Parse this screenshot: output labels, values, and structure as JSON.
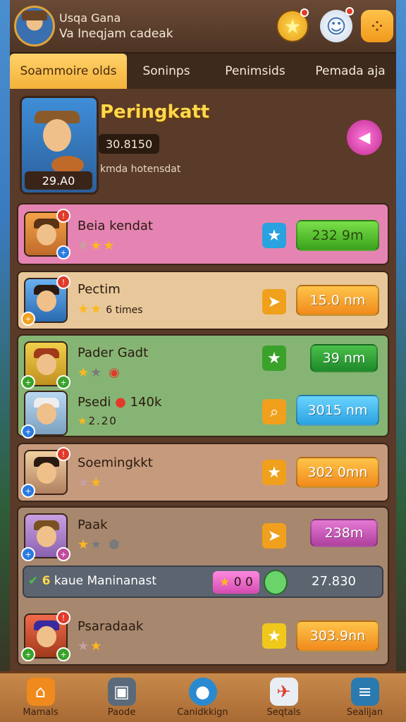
{
  "header": {
    "user_name": "Usqa Gana",
    "user_subtitle": "Va Ineqjam cadeak"
  },
  "tabs": [
    {
      "label": "Soammoire olds",
      "active": true
    },
    {
      "label": "Soninps",
      "active": false
    },
    {
      "label": "Penimsids",
      "active": false
    },
    {
      "label": "Pemada aja",
      "active": false
    }
  ],
  "profile": {
    "title": "Peringkatt",
    "score": "30.8150",
    "subtitle": "kmda hotensdat",
    "level": "29.A0"
  },
  "rows": [
    {
      "name": "Beia kendat",
      "value": "232 9m",
      "color": "#e584b2"
    },
    {
      "name": "Pectim",
      "extra": "6 times",
      "value": "15.0 nm",
      "color": "#e8c89a"
    },
    {
      "name": "Pader Gadt",
      "value": "39 nm",
      "color": "#86b474"
    },
    {
      "name": "Psedi",
      "extra": "140k",
      "sub": "2.20",
      "value": "3015 nm",
      "color": "#86b474"
    },
    {
      "name": "Soemingkkt",
      "value": "302 0mn",
      "color": "#c69a7c"
    },
    {
      "name": "Paak",
      "value": "238m",
      "color": "#a7886e"
    },
    {
      "name": "Psaradaak",
      "value": "303.9nn",
      "color": "#a7886e"
    }
  ],
  "summary": {
    "count": "6",
    "label": "kaue Maninanast",
    "pill": "0 0",
    "value": "27.830"
  },
  "bottom_nav": [
    {
      "label": "Mamals",
      "icon": "home-icon"
    },
    {
      "label": "Paode",
      "icon": "camera-icon"
    },
    {
      "label": "Canidkkign",
      "icon": "orb-icon"
    },
    {
      "label": "Seqtals",
      "icon": "ship-icon"
    },
    {
      "label": "Sealijan",
      "icon": "menu-icon"
    }
  ]
}
